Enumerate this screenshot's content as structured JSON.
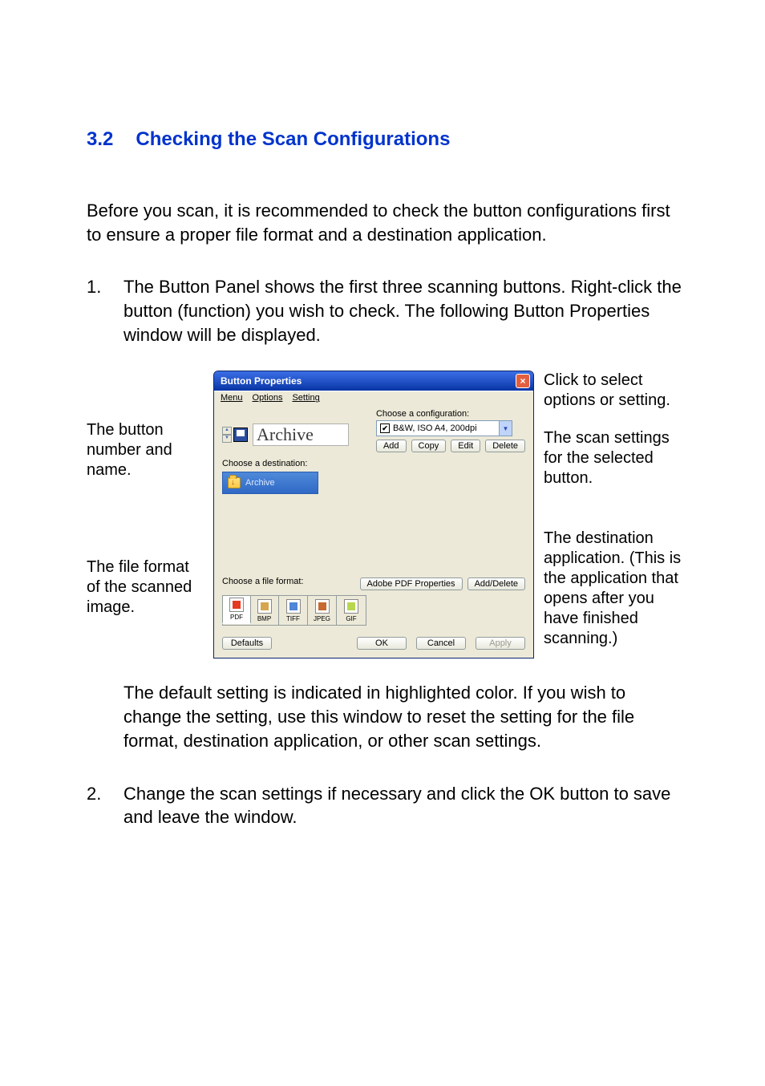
{
  "heading": {
    "number": "3.2",
    "title": "Checking the Scan Configurations"
  },
  "intro": "Before you scan, it is recommended to check the button configurations first to ensure a proper file format and a destination application.",
  "steps": {
    "s1": {
      "n": "1.",
      "text": "The Button Panel shows the first three scanning buttons. Right-click the button (function) you wish to check.   The following Button Properties window will be displayed."
    },
    "s2": {
      "n": "2.",
      "text": "Change the scan settings if necessary and click the OK button to save and leave the window."
    }
  },
  "after_para": "The default setting is indicated in highlighted color.   If you wish to change the setting, use this window to reset the setting for the file format, destination application, or other scan settings.",
  "callouts": {
    "left1": "The button number and name.",
    "left2": "The file format of the scanned image.",
    "right1": "Click to select options or setting.",
    "right2": "The scan settings for the selected button.",
    "right3": "The destination application. (This is the application that opens after you have finished scanning.)"
  },
  "dialog": {
    "title": "Button Properties",
    "menu": {
      "m1": "Menu",
      "m2": "Options",
      "m3": "Setting"
    },
    "button_name": "Archive",
    "config_label": "Choose a configuration:",
    "config_value": "B&W, ISO A4, 200dpi",
    "cfg_buttons": {
      "add": "Add",
      "copy": "Copy",
      "edit": "Edit",
      "del": "Delete"
    },
    "dest_label": "Choose a destination:",
    "dest_item": "Archive",
    "ff_label": "Choose a file format:",
    "ff_buttons": {
      "pdfprops": "Adobe PDF Properties",
      "adddel": "Add/Delete"
    },
    "formats": {
      "pdf": "PDF",
      "bmp": "BMP",
      "tiff": "TIFF",
      "jpeg": "JPEG",
      "gif": "GIF"
    },
    "bottom": {
      "defaults": "Defaults",
      "ok": "OK",
      "cancel": "Cancel",
      "apply": "Apply"
    }
  }
}
